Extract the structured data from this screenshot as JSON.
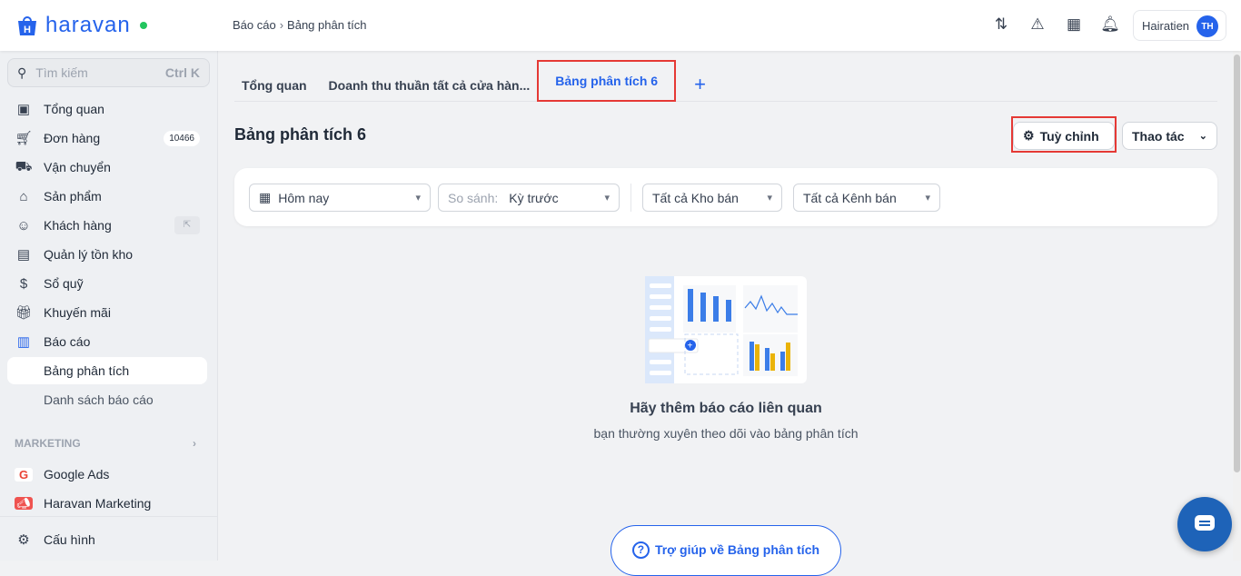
{
  "header": {
    "logo": "haravan",
    "breadcrumb": [
      "Báo cáo",
      "Bảng phân tích"
    ],
    "user_name": "Hairatien",
    "user_initials": "TH"
  },
  "sidebar": {
    "search_placeholder": "Tìm kiếm",
    "search_shortcut": "Ctrl K",
    "items": [
      {
        "label": "Tổng quan"
      },
      {
        "label": "Đơn hàng",
        "badge": "10466"
      },
      {
        "label": "Vận chuyển"
      },
      {
        "label": "Sản phẩm"
      },
      {
        "label": "Khách hàng"
      },
      {
        "label": "Quản lý tồn kho"
      },
      {
        "label": "Sổ quỹ"
      },
      {
        "label": "Khuyến mãi"
      },
      {
        "label": "Báo cáo"
      },
      {
        "label": "Bảng phân tích"
      },
      {
        "label": "Danh sách báo cáo"
      }
    ],
    "marketing_section": "MARKETING",
    "marketing": [
      {
        "label": "Google Ads"
      },
      {
        "label": "Haravan Marketing"
      }
    ],
    "settings": "Cấu hình"
  },
  "tabs": [
    {
      "label": "Tổng quan"
    },
    {
      "label": "Doanh thu thuần tất cả cửa hàn..."
    },
    {
      "label": "Bảng phân tích 6"
    }
  ],
  "page": {
    "title": "Bảng phân tích 6",
    "customize": "Tuỳ chỉnh",
    "actions": "Thao tác"
  },
  "filters": {
    "date": "Hôm nay",
    "compare_label": "So sánh:",
    "compare_value": "Kỳ trước",
    "warehouse": "Tất cả Kho bán",
    "channel": "Tất cả Kênh bán"
  },
  "empty": {
    "title": "Hãy thêm báo cáo liên quan",
    "subtitle": "bạn thường xuyên theo dõi vào bảng phân tích"
  },
  "help": "Trợ giúp về Bảng phân tích",
  "colors": {
    "accent": "#2563eb",
    "highlight": "#e53935",
    "chart_yellow": "#eab308"
  }
}
